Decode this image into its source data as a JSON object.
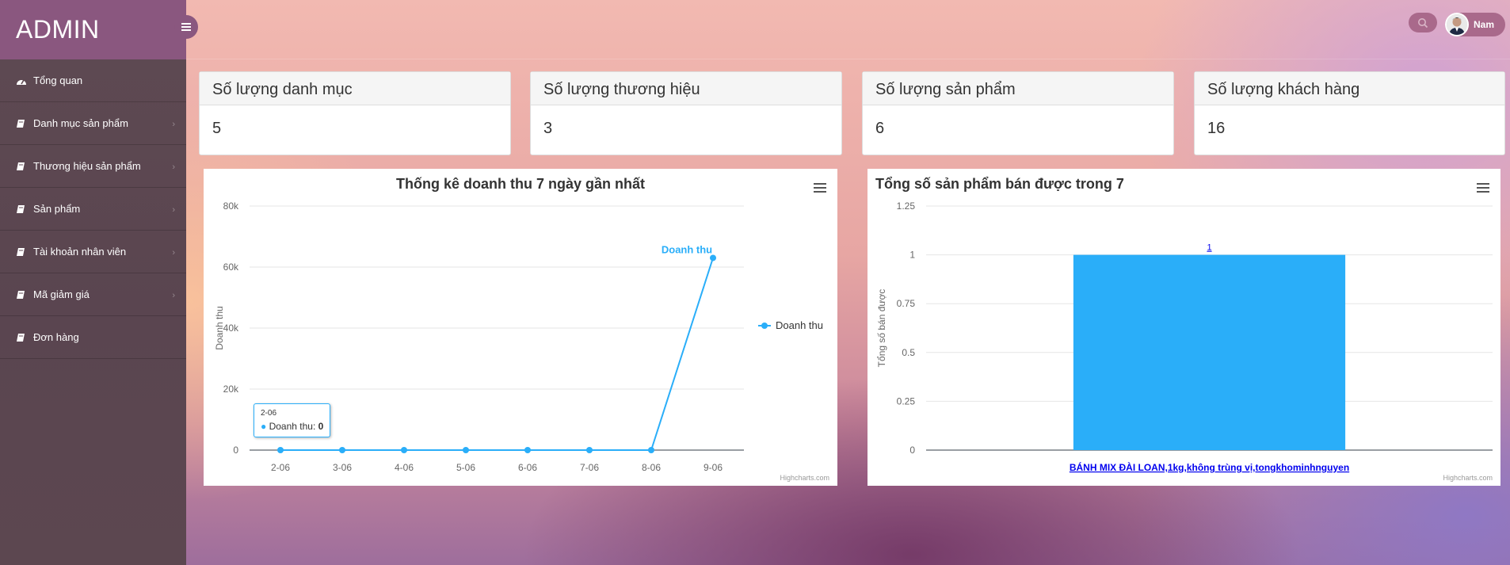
{
  "brand": {
    "title": "ADMIN"
  },
  "sidebar": {
    "items": [
      {
        "label": "Tổng quan",
        "icon": "dashboard-icon"
      },
      {
        "label": "Danh mục sản phẩm",
        "icon": "book-icon"
      },
      {
        "label": "Thương hiệu sản phẩm",
        "icon": "book-icon"
      },
      {
        "label": "Sản phẩm",
        "icon": "book-icon"
      },
      {
        "label": "Tài khoản nhân viên",
        "icon": "book-icon"
      },
      {
        "label": "Mã giảm giá",
        "icon": "book-icon"
      },
      {
        "label": "Đơn hàng",
        "icon": "book-icon"
      }
    ]
  },
  "header": {
    "user_name": "Nam"
  },
  "stats": [
    {
      "label": "Số lượng danh mục",
      "value": "5"
    },
    {
      "label": "Số lượng thương hiệu",
      "value": "3"
    },
    {
      "label": "Số lượng sản phẩm",
      "value": "6"
    },
    {
      "label": "Số lượng khách hàng",
      "value": "16"
    }
  ],
  "colors": {
    "accent": "#2aaef9",
    "sidebar_brand": "#8a577f",
    "sidebar_bg": "#5c4750"
  },
  "credits": "Highcharts.com",
  "tooltip": {
    "title": "2-06",
    "series": "Doanh thu",
    "value": "0"
  },
  "chart_data": [
    {
      "type": "line",
      "title": "Thống kê doanh thu 7 ngày gần nhất",
      "xlabel": "",
      "ylabel": "Doanh thu",
      "categories": [
        "2-06",
        "3-06",
        "4-06",
        "5-06",
        "6-06",
        "7-06",
        "8-06",
        "9-06"
      ],
      "series": [
        {
          "name": "Doanh thu",
          "values": [
            0,
            0,
            0,
            0,
            0,
            0,
            0,
            63000
          ]
        }
      ],
      "ylim": [
        0,
        80000
      ],
      "yticks": [
        "0",
        "20k",
        "40k",
        "60k",
        "80k"
      ],
      "annotation": "Doanh thu",
      "legend": "right",
      "grid": true
    },
    {
      "type": "bar",
      "title": "Tổng số sản phẩm bán được trong 7",
      "xlabel": "",
      "ylabel": "Tổng số bán được",
      "categories": [
        "BÁNH MIX ĐÀI LOAN,1kg,không trùng vị,tongkhominhnguyen"
      ],
      "values": [
        1
      ],
      "data_labels": [
        "1"
      ],
      "ylim": [
        0,
        1.25
      ],
      "yticks": [
        "0",
        "0.25",
        "0.5",
        "0.75",
        "1",
        "1.25"
      ],
      "grid": true
    }
  ]
}
